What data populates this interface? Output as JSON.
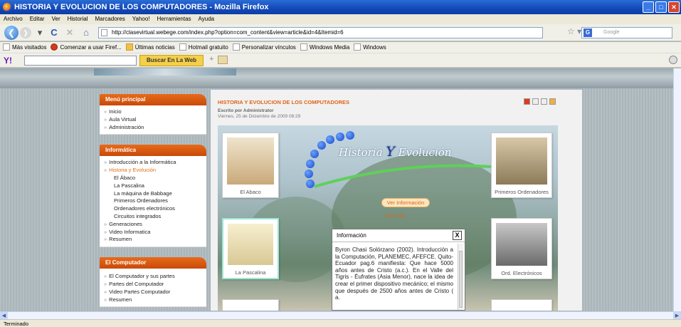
{
  "window": {
    "title": "HISTORIA Y EVOLUCION DE LOS COMPUTADORES - Mozilla Firefox"
  },
  "menu": [
    "Archivo",
    "Editar",
    "Ver",
    "Historial",
    "Marcadores",
    "Yahoo!",
    "Herramientas",
    "Ayuda"
  ],
  "nav": {
    "url": "http://clasevirtual.webege.com/index.php?option=com_content&view=article&id=4&Itemid=6",
    "search_placeholder": "Google"
  },
  "bookmarks": [
    "Más visitados",
    "Comenzar a usar Firef...",
    "Últimas noticias",
    "Hotmail gratuito",
    "Personalizar vínculos",
    "Windows Media",
    "Windows"
  ],
  "yahoo": {
    "logo": "Y!",
    "search_button": "Buscar En La Web"
  },
  "menu_principal": {
    "title": "Menú principal",
    "items": [
      "Inicio",
      "Aula Virtual",
      "Administración"
    ]
  },
  "informatica": {
    "title": "Informática",
    "items": [
      "Introducción a la Informática",
      "Historia y Evolución"
    ],
    "subitems": [
      "El Ábaco",
      "La Pascalina",
      "La máquina de Babbage",
      "Primeros Ordenadores",
      "Ordenadores electrónicos",
      "Circuitos integrados"
    ],
    "items2": [
      "Generaciones",
      "Video Informatica",
      "Resumen"
    ]
  },
  "el_computador": {
    "title": "El Computador",
    "items": [
      "El Computador y sus partes",
      "Partes del Computador",
      "Video Partes Computador",
      "Resumen"
    ]
  },
  "article": {
    "title": "HISTORIA Y EVOLUCION DE LOS COMPUTADORES",
    "author": "Escrito por Administrator",
    "date": "Viernes, 25 de Diciembre de 2009 08:29"
  },
  "scene": {
    "logo_text_a": "Historia ",
    "logo_text_b": "Y",
    "logo_text_c": " Evolución",
    "cards": {
      "abaco": "El Abaco",
      "pascalina": "La Pascalina",
      "primeros": "Primeros Ordenadores",
      "electronicos": "Ord. Electrónicos"
    },
    "ver_button": "Ver Información",
    "ver_link": "Ver más"
  },
  "popup": {
    "title": "Información",
    "close": "X",
    "body": "Byron Chasi Solórzano (2002). Introducción a la Computación, PLANEMEC, AFEFCE. Quito-Ecuador pag.6 manifiesta: Que hace 5000 años antes de Cristo (a.c.). En el Valle del Tigris - Éufrates (Asia Menor), nace la idea de crear el primer dispositivo mecánico; el mismo que después de 2500 años antes de Cristo ( a."
  },
  "status": "Terminado"
}
